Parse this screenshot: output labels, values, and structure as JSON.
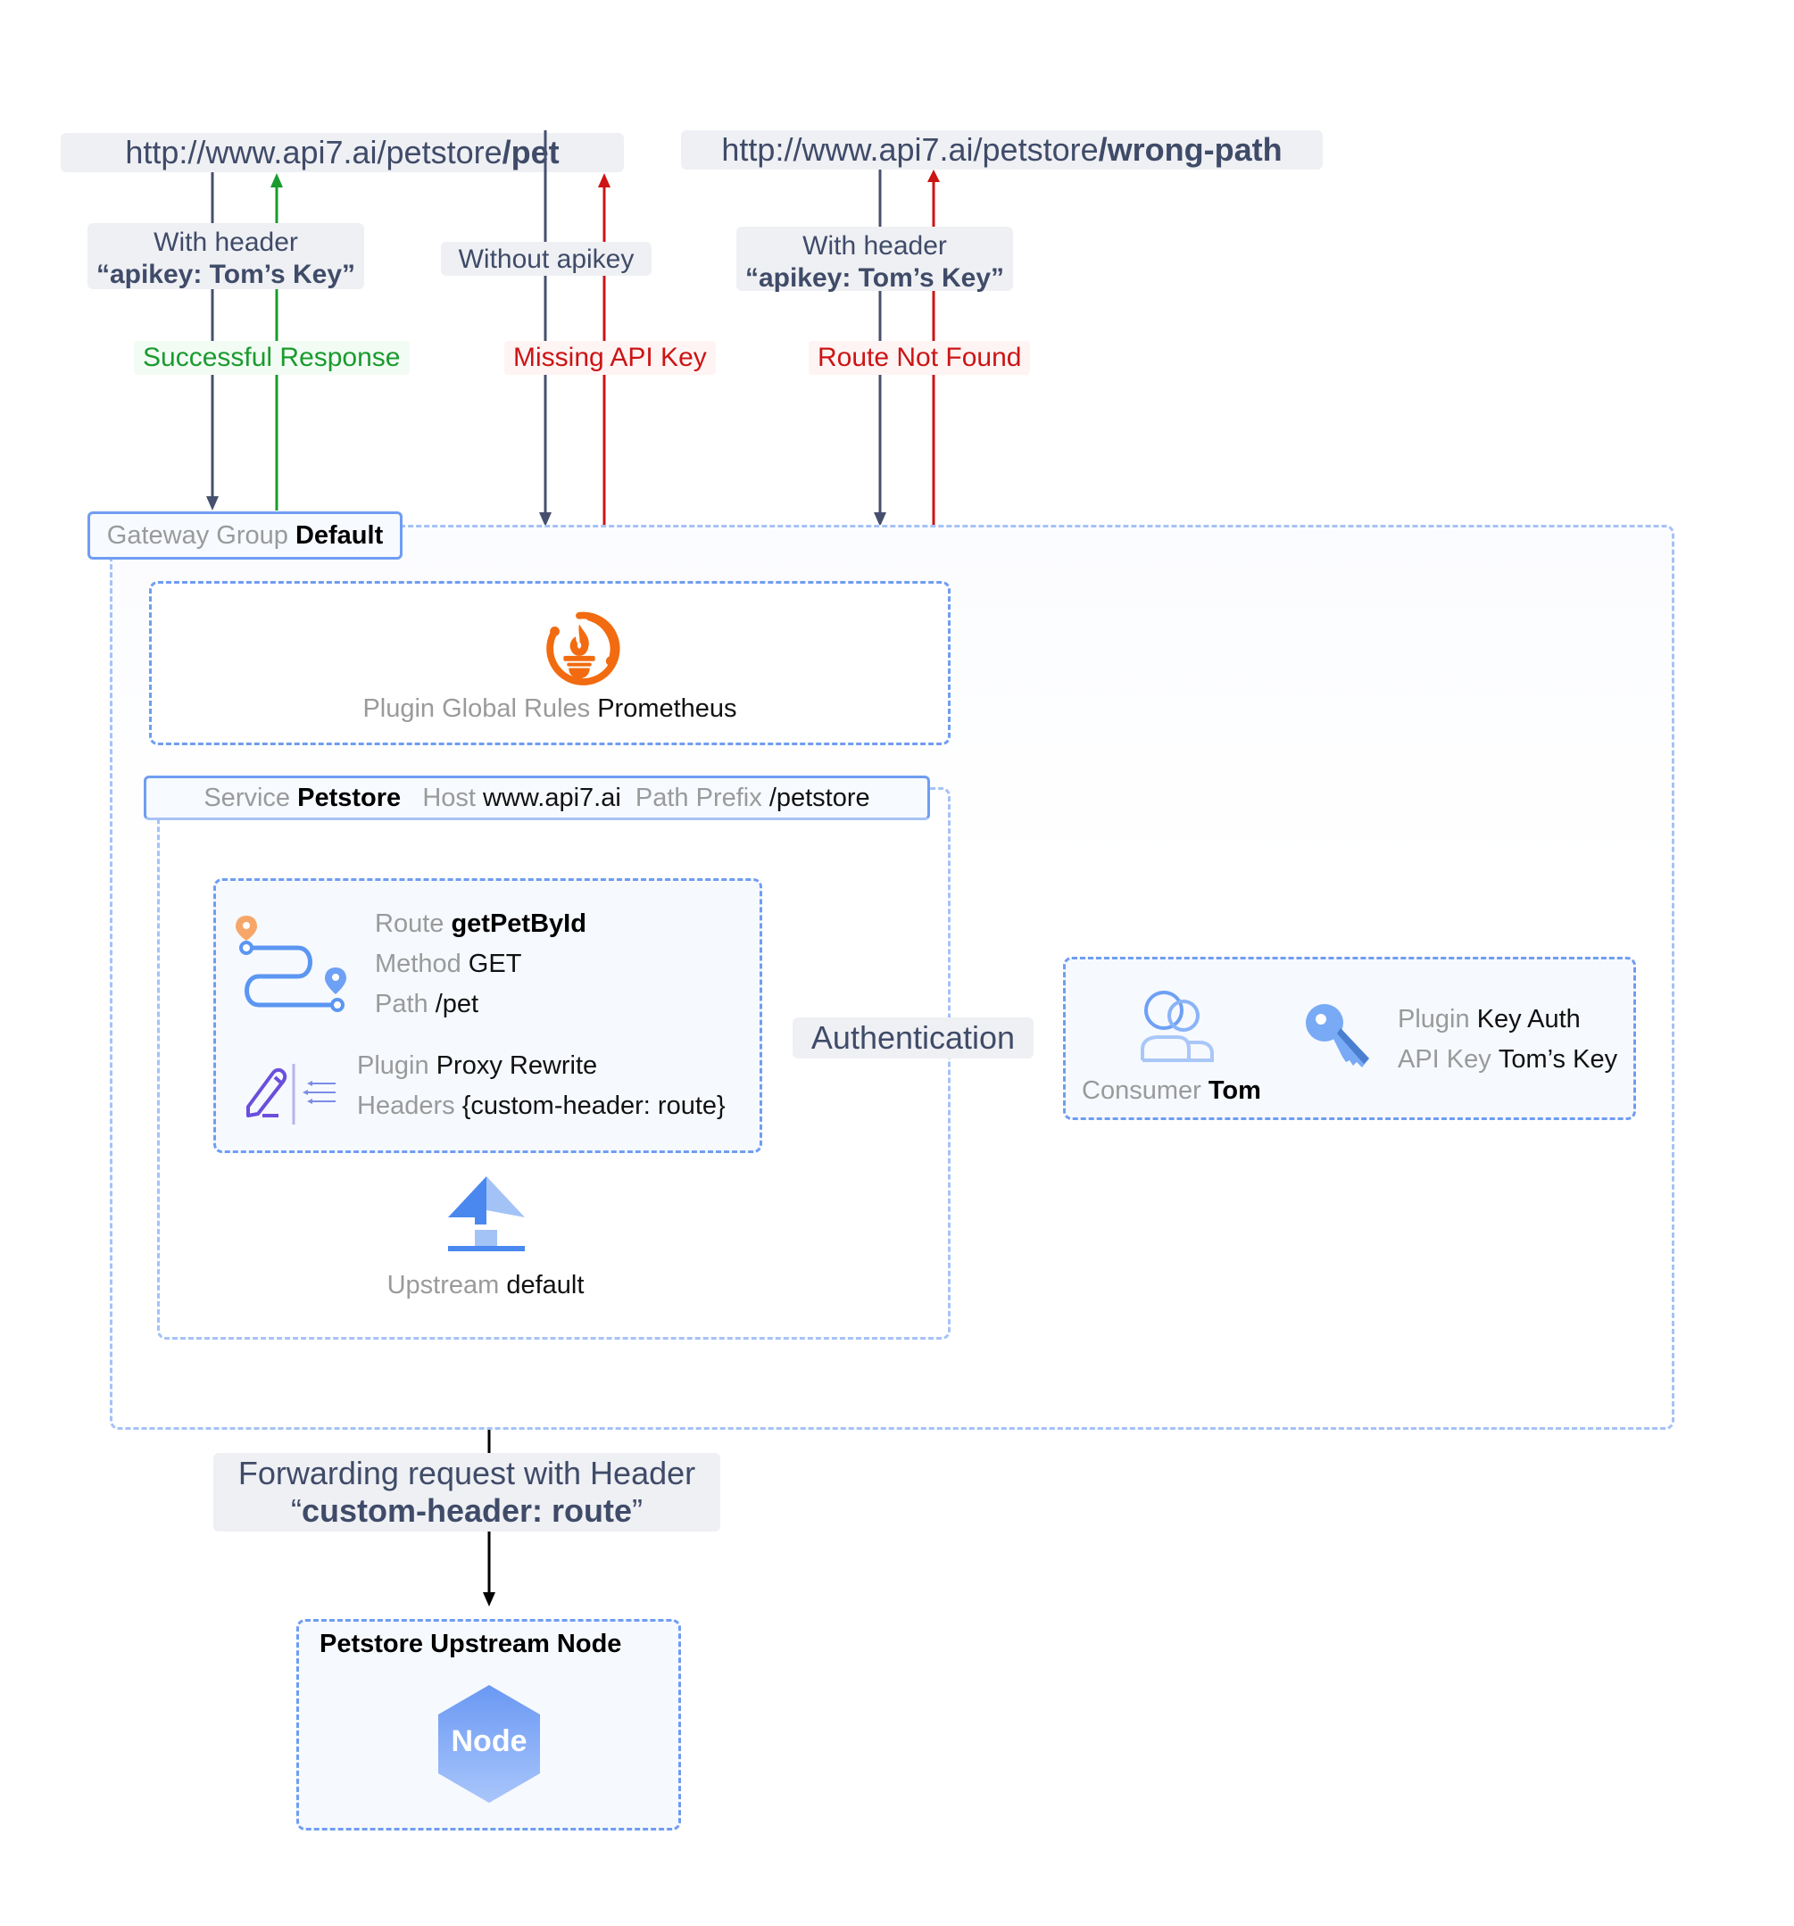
{
  "requests": [
    {
      "url_base": "http://www.api7.ai/petstore",
      "url_path": "/pet"
    },
    {
      "url_base": "http://www.api7.ai/petstore",
      "url_path": "/wrong-path"
    }
  ],
  "flows": [
    {
      "request_line1": "With header",
      "request_line2": "“apikey: Tom’s Key”",
      "response": "Successful Response",
      "status": "success"
    },
    {
      "request_line1": "Without apikey",
      "response": "Missing API Key",
      "status": "error"
    },
    {
      "request_line1": "With header",
      "request_line2": "“apikey: Tom’s Key”",
      "response": "Route Not Found",
      "status": "error"
    }
  ],
  "gateway_group": {
    "key": "Gateway Group",
    "value": "Default"
  },
  "global_rules": {
    "key": "Plugin Global Rules",
    "value": "Prometheus",
    "icon": "prometheus-icon"
  },
  "service": {
    "key": "Service",
    "name": "Petstore",
    "host_key": "Host",
    "host": "www.api7.ai",
    "prefix_key": "Path Prefix",
    "prefix": "/petstore"
  },
  "route": {
    "route_key": "Route",
    "route_name": "getPetById",
    "method_key": "Method",
    "method": "GET",
    "path_key": "Path",
    "path": "/pet",
    "plugin_key": "Plugin",
    "plugin": "Proxy Rewrite",
    "headers_key": "Headers",
    "headers": "{custom-header: route}"
  },
  "authentication_label": "Authentication",
  "consumer": {
    "key": "Consumer",
    "name": "Tom",
    "plugin_key": "Plugin",
    "plugin": "Key Auth",
    "apikey_key": "API Key",
    "apikey": "Tom’s Key"
  },
  "upstream": {
    "key": "Upstream",
    "value": "default"
  },
  "forwarding": {
    "line1": "Forwarding request with Header",
    "line2": "custom-header: route",
    "open_quote": "“",
    "close_quote": "”"
  },
  "upstream_node": {
    "title": "Petstore Upstream Node",
    "node_label": "Node"
  },
  "colors": {
    "request_arrow": "#46506e",
    "success": "#1a9b2f",
    "error": "#cc1414",
    "dashed_border": "#6f9df2",
    "prometheus": "#f26b10"
  }
}
